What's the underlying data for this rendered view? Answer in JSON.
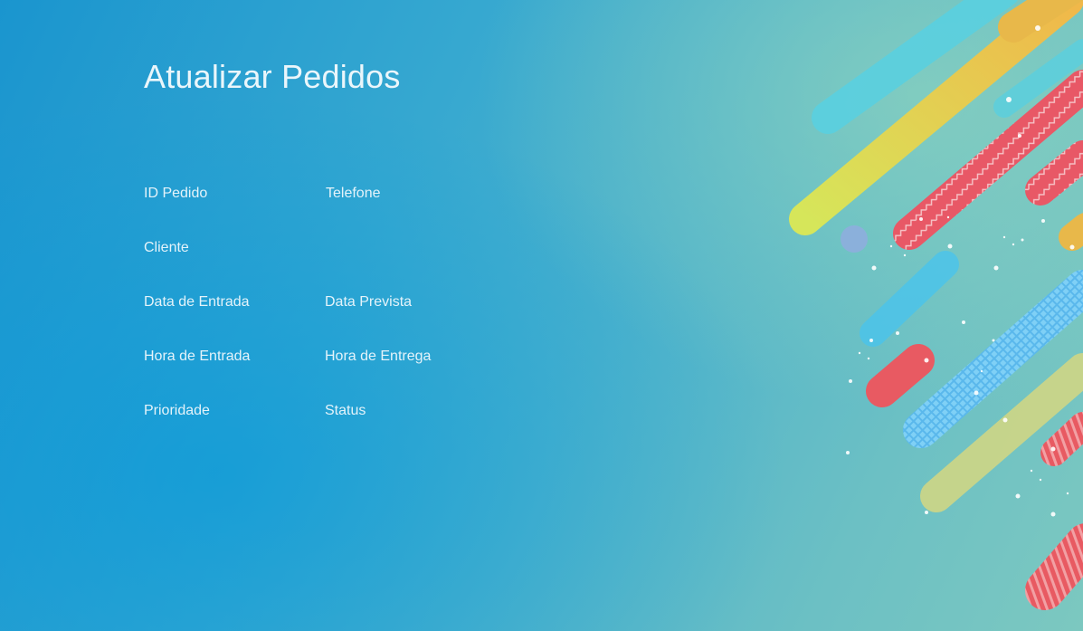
{
  "page": {
    "title": "Atualizar Pedidos"
  },
  "form": {
    "id_pedido": "ID Pedido",
    "telefone": "Telefone",
    "cliente": "Cliente",
    "data_entrada": "Data de Entrada",
    "data_prevista": "Data Prevista",
    "hora_entrada": "Hora de Entrada",
    "hora_entrega": "Hora de Entrega",
    "prioridade": "Prioridade",
    "status": "Status"
  },
  "theme": {
    "accent_colors": [
      "#5ad0e0",
      "#d8e25a",
      "#e8545e",
      "#f0b84a",
      "#6cc8f0"
    ]
  }
}
